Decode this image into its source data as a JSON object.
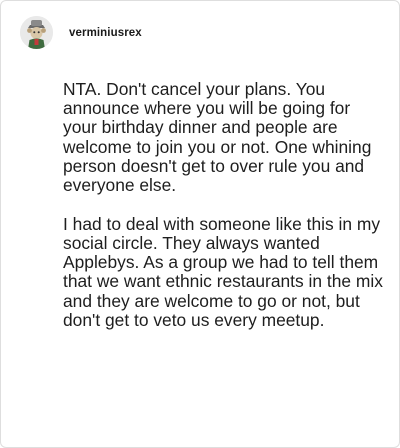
{
  "post": {
    "username": "verminiusrex",
    "avatar_icon": "cartoon-avatar-icon",
    "paragraphs": [
      "NTA. Don't cancel your plans. You announce where you will be going for your birthday dinner and people are welcome to join you or not. One whining person doesn't get to over rule you and everyone else.",
      "I had to deal with someone like this in my social circle. They always wanted Applebys. As a group we had to tell them that we want ethnic restaurants in the mix and they are welcome to go or not, but don't get to veto us every meetup."
    ]
  },
  "colors": {
    "text": "#1e1e1e",
    "username": "#1a1a1a",
    "border": "#dedede",
    "background": "#ffffff"
  }
}
